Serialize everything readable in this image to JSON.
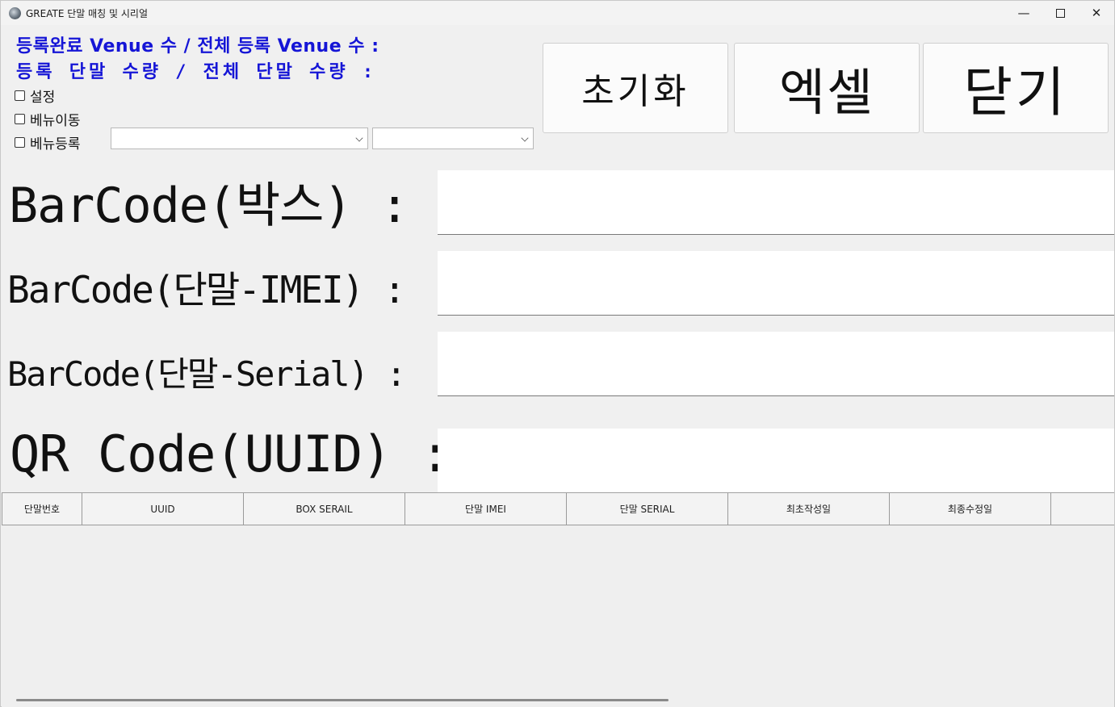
{
  "window": {
    "title": "GREATE 단말 매칭 및 시리얼",
    "minimize_glyph": "—",
    "close_glyph": "✕"
  },
  "status": {
    "venue_line": "등록완료 Venue 수 / 전체 등록 Venue 수 :",
    "device_line": "등록 단말 수량 / 전체 단말 수량 :"
  },
  "options": {
    "settings": "설정",
    "venue_move": "베뉴이동",
    "venue_register": "베뉴등록"
  },
  "combos": {
    "first_value": "",
    "second_value": ""
  },
  "buttons": {
    "reset": "초기화",
    "excel": "엑셀",
    "close": "닫기"
  },
  "barcodes": {
    "box_label": "BarCode(박스) :",
    "box_value": "",
    "imei_label": "BarCode(단말-IMEI) :",
    "imei_value": "",
    "serial_label": "BarCode(단말-Serial) :",
    "serial_value": "",
    "qr_label": "QR Code(UUID) :",
    "qr_value": ""
  },
  "grid": {
    "columns": [
      "단말번호",
      "UUID",
      "BOX SERAIL",
      "단말 IMEI",
      "단말 SERIAL",
      "최초작성일",
      "최종수정일",
      ""
    ]
  },
  "icons": {
    "app": "app-icon",
    "minimize": "minimize-icon",
    "maximize": "maximize-icon",
    "close": "close-icon",
    "dropdown": "chevron-down-icon"
  }
}
